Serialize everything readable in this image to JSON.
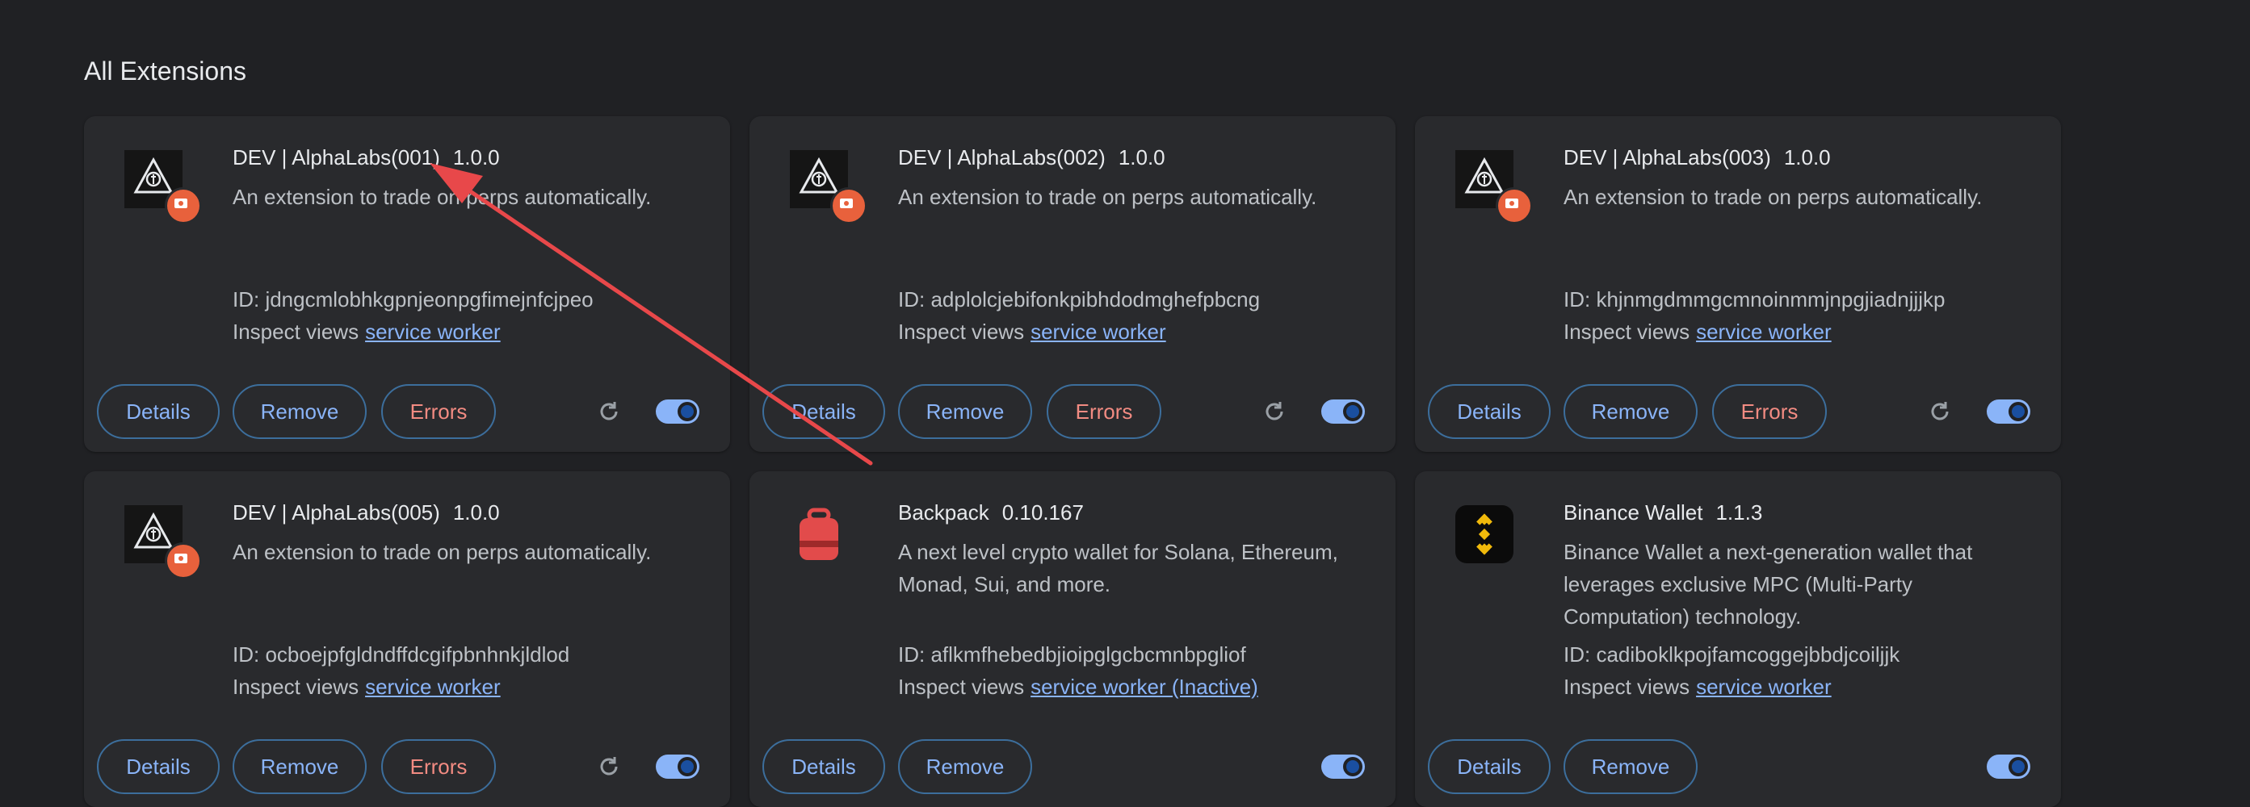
{
  "section_title": "All Extensions",
  "cards": [
    {
      "name": "DEV | AlphaLabs(001)",
      "version": "1.0.0",
      "desc": "An extension to trade on perps automatically.",
      "id": "ID: jdngcmlobhkgpnjeonpgfimejnfcjpeo",
      "inspect_label": "Inspect views",
      "inspect_link": "service worker",
      "details": "Details",
      "remove": "Remove",
      "errors": "Errors",
      "icon": "alphalabs-icon",
      "enabled": true
    },
    {
      "name": "DEV | AlphaLabs(002)",
      "version": "1.0.0",
      "desc": "An extension to trade on perps automatically.",
      "id": "ID: adplolcjebifonkpibhdodmghefpbcng",
      "inspect_label": "Inspect views",
      "inspect_link": "service worker",
      "details": "Details",
      "remove": "Remove",
      "errors": "Errors",
      "icon": "alphalabs-icon",
      "enabled": true
    },
    {
      "name": "DEV | AlphaLabs(003)",
      "version": "1.0.0",
      "desc": "An extension to trade on perps automatically.",
      "id": "ID: khjnmgdmmgcmnoinmmjnpgjiadnjjjkp",
      "inspect_label": "Inspect views",
      "inspect_link": "service worker",
      "details": "Details",
      "remove": "Remove",
      "errors": "Errors",
      "icon": "alphalabs-icon",
      "enabled": true
    },
    {
      "name": "DEV | AlphaLabs(005)",
      "version": "1.0.0",
      "desc": "An extension to trade on perps automatically.",
      "id": "ID: ocboejpfgldndffdcgifpbnhnkjldlod",
      "inspect_label": "Inspect views",
      "inspect_link": "service worker",
      "details": "Details",
      "remove": "Remove",
      "errors": "Errors",
      "icon": "alphalabs-icon",
      "enabled": true
    },
    {
      "name": "Backpack",
      "version": "0.10.167",
      "desc": "A next level crypto wallet for Solana, Ethereum, Monad, Sui, and more.",
      "id": "ID: aflkmfhebedbjioipglgcbcmnbpgliof",
      "inspect_label": "Inspect views",
      "inspect_link": "service worker (Inactive)",
      "details": "Details",
      "remove": "Remove",
      "icon": "backpack-icon",
      "enabled": true
    },
    {
      "name": "Binance Wallet",
      "version": "1.1.3",
      "desc": "Binance Wallet a next-generation wallet that leverages exclusive MPC (Multi-Party Computation) technology.",
      "id": "ID: cadiboklkpojfamcoggejbbdjcoiljjk",
      "inspect_label": "Inspect views",
      "inspect_link": "service worker",
      "details": "Details",
      "remove": "Remove",
      "icon": "binance-icon",
      "enabled": true
    }
  ],
  "colors": {
    "background": "#202124",
    "card": "#292a2d",
    "accent": "#8ab4f8",
    "error": "#f28b82",
    "annotation_arrow": "#e8484a"
  }
}
